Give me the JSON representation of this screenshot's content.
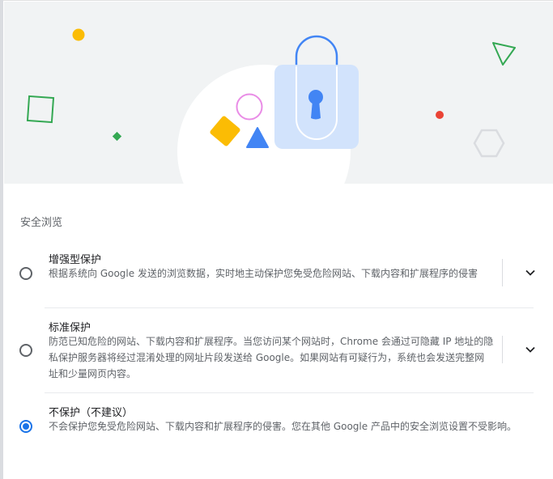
{
  "section_title": "安全浏览",
  "options": [
    {
      "title": "增强型保护",
      "description": "根据系统向 Google 发送的浏览数据，实时地主动保护您免受危险网站、下载内容和扩展程序的侵害",
      "checked": false,
      "expand_icon": "chevron-down-icon"
    },
    {
      "title": "标准保护",
      "description": "防范已知危险的网站、下载内容和扩展程序。当您访问某个网站时，Chrome 会通过可隐藏 IP 地址的隐私保护服务器将经过混淆处理的网址片段发送给 Google。如果网站有可疑行为，系统也会发送完整网址和少量网页内容。",
      "checked": false,
      "expand_icon": "chevron-down-icon"
    },
    {
      "title": "不保护（不建议）",
      "description": "不会保护您免受危险网站、下载内容和扩展程序的侵害。您在其他 Google 产品中的安全浏览设置不受影响。",
      "checked": true
    }
  ],
  "colors": {
    "accent": "#1a73e8",
    "illustration_blue": "#4285f4",
    "illustration_yellow": "#fbbc04",
    "illustration_green": "#34a853",
    "illustration_red": "#ea4335",
    "illustration_pink": "#e98ce6",
    "lock_body": "#d2e3fc"
  }
}
